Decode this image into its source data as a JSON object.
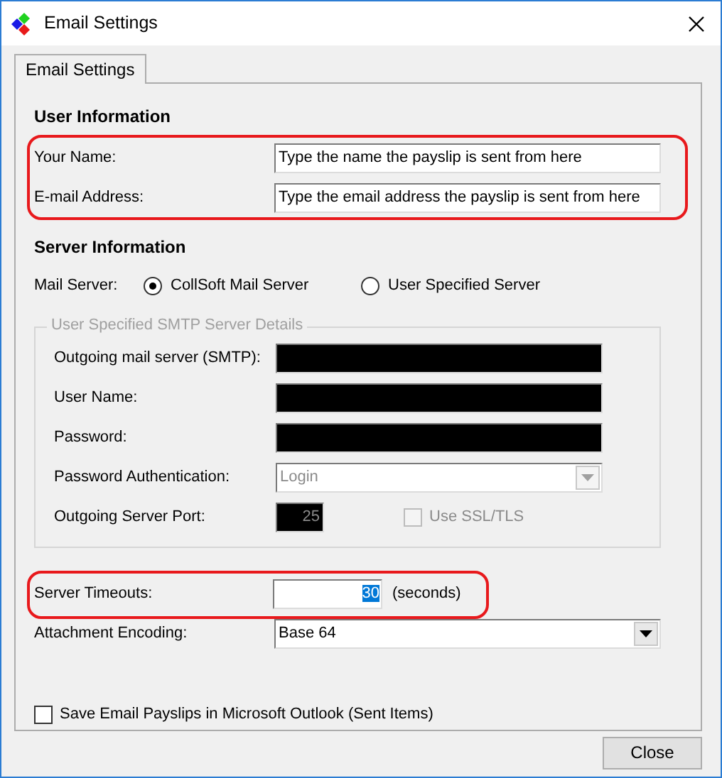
{
  "window": {
    "title": "Email Settings"
  },
  "tabs": [
    {
      "label": "Email Settings",
      "selected": true
    }
  ],
  "user_information": {
    "heading": "User Information",
    "highlighted": true,
    "fields": [
      {
        "label": "Your Name:",
        "value": "Type the name the payslip is sent from here"
      },
      {
        "label": "E-mail Address:",
        "value": "Type the email address the payslip is sent from here"
      }
    ]
  },
  "server_information": {
    "heading": "Server Information",
    "mail_server": {
      "label": "Mail Server:",
      "options": [
        {
          "label": "CollSoft Mail Server",
          "selected": true
        },
        {
          "label": "User Specified Server",
          "selected": false
        }
      ]
    },
    "smtp_details": {
      "legend": "User Specified SMTP Server Details",
      "disabled": true,
      "rows": [
        {
          "kind": "text",
          "label": "Outgoing mail server (SMTP):",
          "redacted": true
        },
        {
          "kind": "text",
          "label": "User Name:",
          "redacted": true
        },
        {
          "kind": "text",
          "label": "Password:",
          "redacted": true
        },
        {
          "kind": "select",
          "label": "Password Authentication:",
          "value": "Login"
        },
        {
          "kind": "port",
          "label": "Outgoing Server Port:",
          "value": "25",
          "redacted": true,
          "checkbox": {
            "label": "Use SSL/TLS",
            "checked": false
          }
        }
      ]
    }
  },
  "server_timeouts": {
    "label": "Server Timeouts:",
    "value": "30",
    "value_selected": true,
    "unit": "(seconds)",
    "highlighted": true
  },
  "attachment_encoding": {
    "label": "Attachment Encoding:",
    "value": "Base 64"
  },
  "save_in_outlook": {
    "label": "Save Email Payslips in Microsoft Outlook (Sent Items)",
    "checked": false
  },
  "buttons": [
    {
      "label": "Close"
    }
  ]
}
